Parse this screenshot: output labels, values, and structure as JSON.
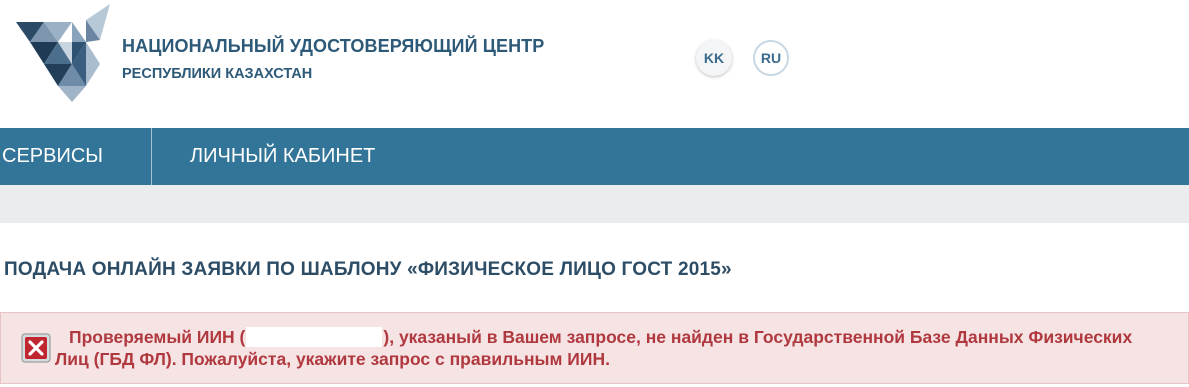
{
  "header": {
    "org_title": "НАЦИОНАЛЬНЫЙ УДОСТОВЕРЯЮЩИЙ ЦЕНТР",
    "org_subtitle": "РЕСПУБЛИКИ КАЗАХСТАН",
    "logo_icon": "nuc-triangle-logo-icon",
    "languages": [
      {
        "code": "KK",
        "active": false
      },
      {
        "code": "RU",
        "active": true
      }
    ]
  },
  "nav": {
    "items": [
      {
        "label": "СЕРВИСЫ"
      },
      {
        "label": "ЛИЧНЫЙ КАБИНЕТ"
      }
    ]
  },
  "main": {
    "page_title": "ПОДАЧА ОНЛАЙН ЗАЯВКИ ПО ШАБЛОНУ «ФИЗИЧЕСКОЕ ЛИЦО ГОСТ 2015»",
    "error": {
      "icon": "error-close-icon",
      "text_before": "Проверяемый ИИН (",
      "text_after": "), указаный в Вашем запросе, не найден в Государственной Базе Данных Физических Лиц (ГБД ФЛ). Пожалуйста, укажите запрос с правильным ИИН."
    }
  },
  "colors": {
    "brand_blue": "#337598",
    "heading": "#2d5a78",
    "error_text": "#b0383f",
    "error_bg": "#f6e4e4"
  }
}
